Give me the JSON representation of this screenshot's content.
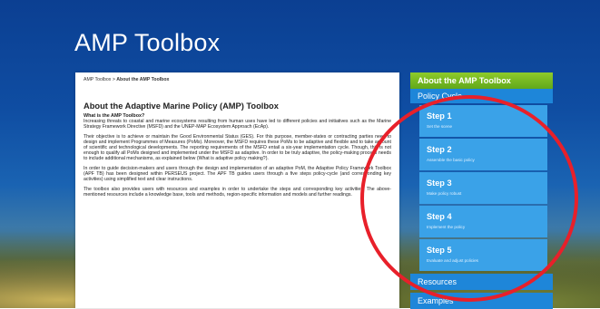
{
  "header": {
    "title": "AMP Toolbox"
  },
  "breadcrumb": {
    "home": "AMP Toolbox",
    "separator": " > ",
    "current": "About the AMP Toolbox"
  },
  "main": {
    "heading": "About the Adaptive Marine Policy (AMP) Toolbox",
    "subheading": "What is the AMP Toolbox?",
    "paragraphs": [
      "Increasing threats to coastal and marine ecosystems resulting from human uses have led to different policies and initiatives such as the Marine Strategy Framework Directive (MSFD) and the UNEP-MAP Ecosystem Approach (EcAp).",
      "Their objective is to achieve or maintain the Good Environmental Status (GES). For this purpose, member-states or contracting parties need to design and implement Programmes of Measures (PoMs). Moreover, the MSFD requires these PoMs to be adaptive and flexible and to take account of scientific and technological developments. The reporting requirements of the MSFD entail a six-year implementation cycle. Though, this is not enough to qualify all PoMs designed and implemented under the MSFD as adaptive. In order to be truly adaptive, the policy-making process needs to include additional mechanisms, as explained below (What is adaptive policy making?).",
      "In order to guide decision-makers and users through the design and implementation of an adaptive PoM, the Adaptive Policy Framework Toolbox (APF TB) has been designed within PERSEUS project. The APF TB guides users through a five steps policy-cycle (and corresponding key activities) using simplified text and clear instructions.",
      "The toolbox also provides users with resources and examples in order to undertake the steps and corresponding key activities. The above-mentioned resources include a knowledge base, tools and methods, region-specific information and models and further readings."
    ]
  },
  "sidebar": {
    "about": "About the AMP Toolbox",
    "policy_cycle": "Policy Cycle",
    "steps": [
      {
        "label": "Step 1",
        "sub": "Set the scene"
      },
      {
        "label": "Step 2",
        "sub": "Assemble the basic policy"
      },
      {
        "label": "Step 3",
        "sub": "Make policy robust"
      },
      {
        "label": "Step 4",
        "sub": "Implement the policy"
      },
      {
        "label": "Step 5",
        "sub": "Evaluate and adjust policies"
      }
    ],
    "resources": "Resources",
    "examples": "Examples"
  },
  "colors": {
    "accent_green": "#7abf22",
    "nav_blue": "#1e86d9",
    "step_blue": "#3aa2e8",
    "highlight_red": "#e8202a"
  }
}
